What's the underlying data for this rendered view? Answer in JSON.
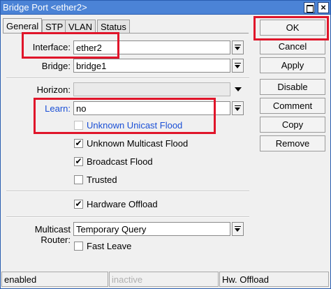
{
  "window": {
    "title": "Bridge Port <ether2>",
    "close_glyph": "×"
  },
  "tabs": [
    {
      "label": "General"
    },
    {
      "label": "STP"
    },
    {
      "label": "VLAN"
    },
    {
      "label": "Status"
    }
  ],
  "form": {
    "interface": {
      "label": "Interface:",
      "value": "ether2"
    },
    "bridge": {
      "label": "Bridge:",
      "value": "bridge1"
    },
    "horizon": {
      "label": "Horizon:",
      "value": ""
    },
    "learn": {
      "label": "Learn:",
      "value": "no"
    },
    "unknown_unicast_flood": {
      "label": "Unknown Unicast Flood",
      "checked": ""
    },
    "unknown_multicast_flood": {
      "label": "Unknown Multicast Flood",
      "checked": "✔"
    },
    "broadcast_flood": {
      "label": "Broadcast Flood",
      "checked": "✔"
    },
    "trusted": {
      "label": "Trusted",
      "checked": ""
    },
    "hardware_offload": {
      "label": "Hardware Offload",
      "checked": "✔"
    },
    "multicast_router": {
      "label": "Multicast Router:",
      "value": "Temporary Query"
    },
    "fast_leave": {
      "label": "Fast Leave",
      "checked": ""
    }
  },
  "buttons": {
    "ok": "OK",
    "cancel": "Cancel",
    "apply": "Apply",
    "disable": "Disable",
    "comment": "Comment",
    "copy": "Copy",
    "remove": "Remove"
  },
  "status": {
    "state": "enabled",
    "activity": "inactive",
    "hw_offload": "Hw. Offload"
  },
  "colors": {
    "highlight": "#e0152a",
    "title_bar": "#4b83d6",
    "link_label": "#1a4fd6"
  }
}
